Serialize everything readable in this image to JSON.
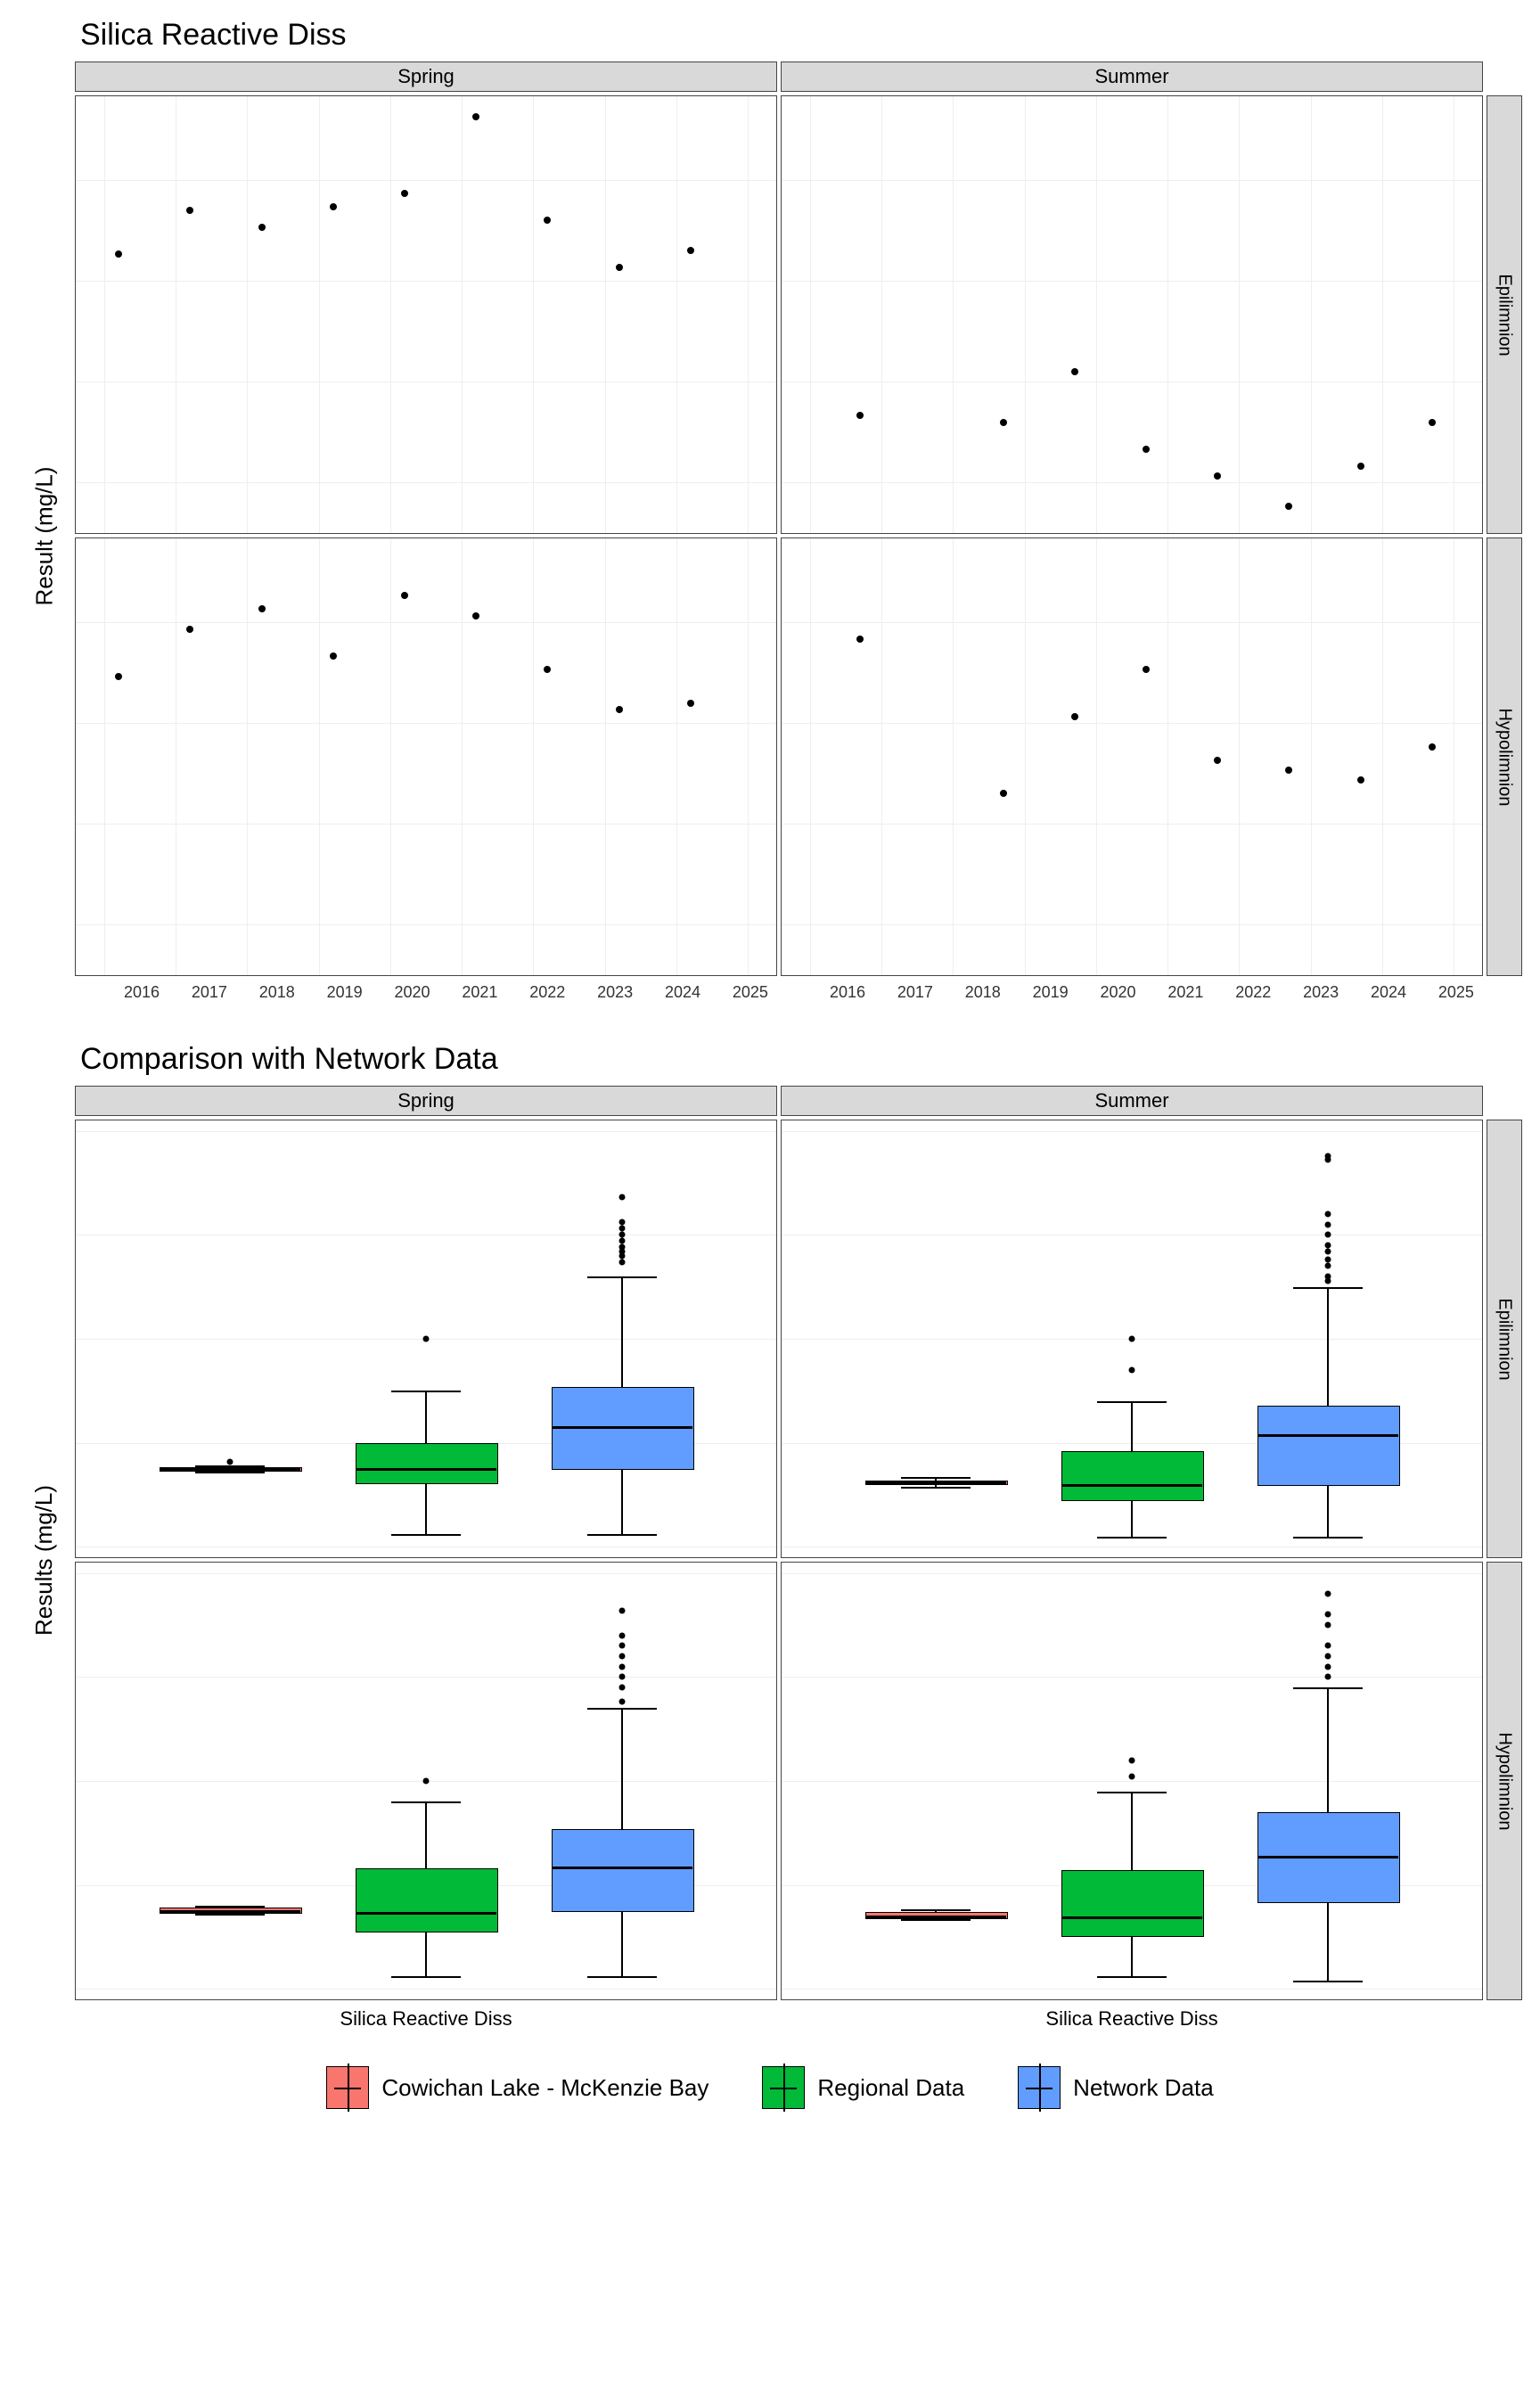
{
  "chart_data": [
    {
      "id": "scatter",
      "title": "Silica Reactive Diss",
      "type": "scatter",
      "ylabel": "Result (mg/L)",
      "cols": [
        "Spring",
        "Summer"
      ],
      "rows": [
        "Epilimnion",
        "Hypolimnion"
      ],
      "x_ticks": [
        "2016",
        "2017",
        "2018",
        "2019",
        "2020",
        "2021",
        "2022",
        "2023",
        "2024",
        "2025"
      ],
      "x_range": [
        2015.6,
        2025.4
      ],
      "y_ticks": [
        3.0,
        3.3,
        3.6,
        3.9
      ],
      "y_range": [
        2.85,
        4.15
      ],
      "panels": {
        "Spring|Epilimnion": [
          [
            2016.2,
            3.68
          ],
          [
            2017.2,
            3.81
          ],
          [
            2018.2,
            3.76
          ],
          [
            2019.2,
            3.82
          ],
          [
            2020.2,
            3.86
          ],
          [
            2021.2,
            4.09
          ],
          [
            2022.2,
            3.78
          ],
          [
            2023.2,
            3.64
          ],
          [
            2024.2,
            3.69
          ]
        ],
        "Summer|Epilimnion": [
          [
            2016.7,
            3.2
          ],
          [
            2018.7,
            3.18
          ],
          [
            2019.7,
            3.33
          ],
          [
            2020.7,
            3.1
          ],
          [
            2021.7,
            3.02
          ],
          [
            2022.7,
            2.93
          ],
          [
            2023.7,
            3.05
          ],
          [
            2024.7,
            3.18
          ]
        ],
        "Spring|Hypolimnion": [
          [
            2016.2,
            3.74
          ],
          [
            2017.2,
            3.88
          ],
          [
            2018.2,
            3.94
          ],
          [
            2019.2,
            3.8
          ],
          [
            2020.2,
            3.98
          ],
          [
            2021.2,
            3.92
          ],
          [
            2022.2,
            3.76
          ],
          [
            2023.2,
            3.64
          ],
          [
            2024.2,
            3.66
          ]
        ],
        "Summer|Hypolimnion": [
          [
            2016.7,
            3.85
          ],
          [
            2018.7,
            3.39
          ],
          [
            2019.7,
            3.62
          ],
          [
            2020.7,
            3.76
          ],
          [
            2021.7,
            3.49
          ],
          [
            2022.7,
            3.46
          ],
          [
            2023.7,
            3.43
          ],
          [
            2024.7,
            3.53
          ]
        ]
      }
    },
    {
      "id": "box",
      "title": "Comparison with Network Data",
      "type": "boxplot",
      "ylabel": "Results (mg/L)",
      "cols": [
        "Spring",
        "Summer"
      ],
      "rows": [
        "Epilimnion",
        "Hypolimnion"
      ],
      "x_label": "Silica Reactive Diss",
      "y_ticks": [
        0,
        5,
        10,
        15,
        20
      ],
      "y_range": [
        -0.5,
        20.5
      ],
      "series": [
        "Cowichan Lake - McKenzie Bay",
        "Regional Data",
        "Network Data"
      ],
      "series_colors": {
        "Cowichan Lake - McKenzie Bay": "#F8766D",
        "Regional Data": "#00BA38",
        "Network Data": "#619CFF"
      },
      "panels": {
        "Spring|Epilimnion": {
          "Cowichan Lake - McKenzie Bay": {
            "min": 3.6,
            "q1": 3.7,
            "med": 3.8,
            "q3": 3.85,
            "max": 3.9,
            "out": [
              4.1
            ]
          },
          "Regional Data": {
            "min": 0.6,
            "q1": 3.1,
            "med": 3.8,
            "q3": 5.0,
            "max": 7.5,
            "out": [
              10.0
            ]
          },
          "Network Data": {
            "min": 0.6,
            "q1": 3.8,
            "med": 5.8,
            "q3": 7.7,
            "max": 13.0,
            "out": [
              13.7,
              14.0,
              14.2,
              14.4,
              14.7,
              15.0,
              15.3,
              15.6,
              16.8
            ]
          }
        },
        "Summer|Epilimnion": {
          "Cowichan Lake - McKenzie Bay": {
            "min": 2.9,
            "q1": 3.05,
            "med": 3.15,
            "q3": 3.2,
            "max": 3.35,
            "out": []
          },
          "Regional Data": {
            "min": 0.5,
            "q1": 2.3,
            "med": 3.0,
            "q3": 4.6,
            "max": 7.0,
            "out": [
              8.5,
              10.0
            ]
          },
          "Network Data": {
            "min": 0.5,
            "q1": 3.0,
            "med": 5.4,
            "q3": 6.8,
            "max": 12.5,
            "out": [
              12.8,
              13.0,
              13.5,
              13.8,
              14.2,
              14.5,
              15.0,
              15.5,
              16.0,
              18.6,
              18.8
            ]
          }
        },
        "Spring|Hypolimnion": {
          "Cowichan Lake - McKenzie Bay": {
            "min": 3.6,
            "q1": 3.7,
            "med": 3.8,
            "q3": 3.92,
            "max": 4.0,
            "out": []
          },
          "Regional Data": {
            "min": 0.6,
            "q1": 2.8,
            "med": 3.7,
            "q3": 5.8,
            "max": 9.0,
            "out": [
              10.0
            ]
          },
          "Network Data": {
            "min": 0.6,
            "q1": 3.8,
            "med": 5.9,
            "q3": 7.7,
            "max": 13.5,
            "out": [
              13.8,
              14.5,
              15.0,
              15.5,
              16.0,
              16.5,
              17.0,
              18.2
            ]
          }
        },
        "Summer|Hypolimnion": {
          "Cowichan Lake - McKenzie Bay": {
            "min": 3.35,
            "q1": 3.45,
            "med": 3.55,
            "q3": 3.7,
            "max": 3.85,
            "out": []
          },
          "Regional Data": {
            "min": 0.6,
            "q1": 2.6,
            "med": 3.5,
            "q3": 5.7,
            "max": 9.5,
            "out": [
              10.2,
              11.0
            ]
          },
          "Network Data": {
            "min": 0.4,
            "q1": 4.2,
            "med": 6.4,
            "q3": 8.5,
            "max": 14.5,
            "out": [
              15.0,
              15.5,
              16.0,
              16.5,
              17.5,
              18.0,
              19.0
            ]
          }
        }
      }
    }
  ],
  "legend": {
    "items": [
      "Cowichan Lake - McKenzie Bay",
      "Regional Data",
      "Network Data"
    ]
  }
}
